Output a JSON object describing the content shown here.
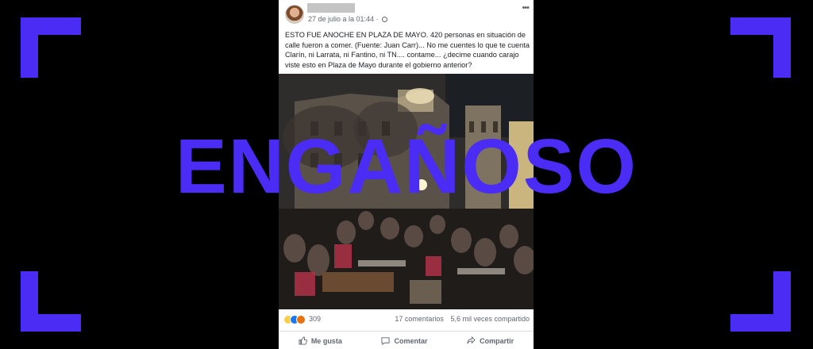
{
  "post": {
    "date": "27 de julio a la 01:44",
    "text": "ESTO FUE ANOCHE EN PLAZA DE MAYO. 420 personas en situación de calle fueron a comer. (Fuente: Juan Carr)... No me cuentes lo que te cuenta Clarín, ni Larrata, ni Fantino, ni TN.... contame... ¿decime cuando carajo viste esto en Plaza de Mayo durante el gobierno anterior?",
    "reaction_count": "309",
    "comments": "17 comentarios",
    "shares": "5,6 mil veces compartido",
    "actions": {
      "like": "Me gusta",
      "comment": "Comentar",
      "share": "Compartir"
    }
  },
  "stamp": "ENGAÑOSO",
  "colors": {
    "accent": "#4a2cf5",
    "background": "#000000"
  },
  "icons": [
    "globe-icon",
    "more-icon",
    "sad-reaction-icon",
    "like-reaction-icon",
    "angry-reaction-icon",
    "thumbs-up-icon",
    "comment-icon",
    "share-icon"
  ]
}
